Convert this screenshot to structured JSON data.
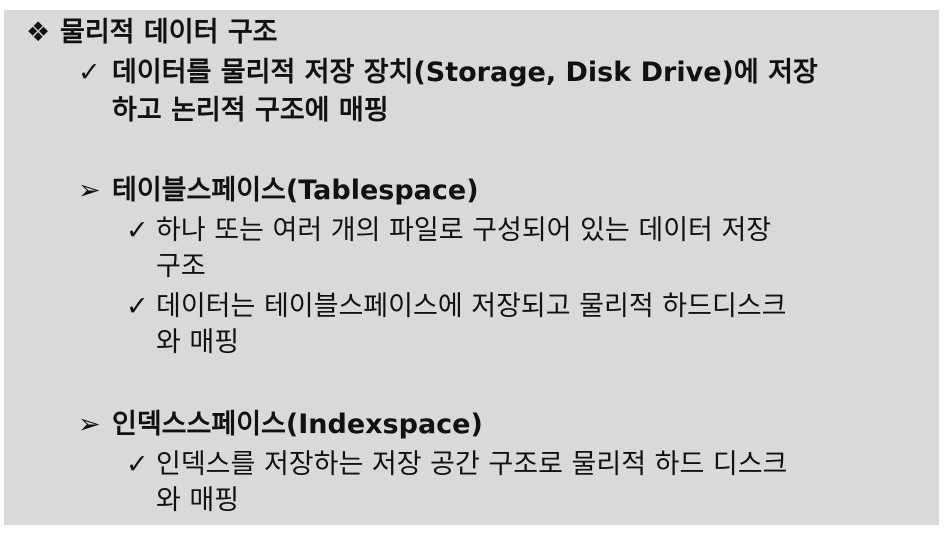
{
  "heading": {
    "bullet": "❖",
    "text": "물리적 데이터 구조"
  },
  "intro": {
    "bullet": "✓",
    "line1": "데이터를 물리적 저장 장치(Storage, Disk Drive)에 저장",
    "line2": "하고 논리적 구조에 매핑"
  },
  "sections": [
    {
      "bullet": "➢",
      "title": "테이블스페이스(Tablespace)",
      "items": [
        {
          "bullet": "✓",
          "line1": "하나 또는 여러 개의 파일로 구성되어 있는 데이터 저장",
          "line2": "구조"
        },
        {
          "bullet": "✓",
          "line1": "데이터는 테이블스페이스에 저장되고 물리적 하드디스크",
          "line2": "와 매핑"
        }
      ]
    },
    {
      "bullet": "➢",
      "title": "인덱스스페이스(Indexspace)",
      "items": [
        {
          "bullet": "✓",
          "line1": "인덱스를 저장하는 저장 공간 구조로 물리적 하드 디스크",
          "line2": "와 매핑"
        }
      ]
    }
  ]
}
